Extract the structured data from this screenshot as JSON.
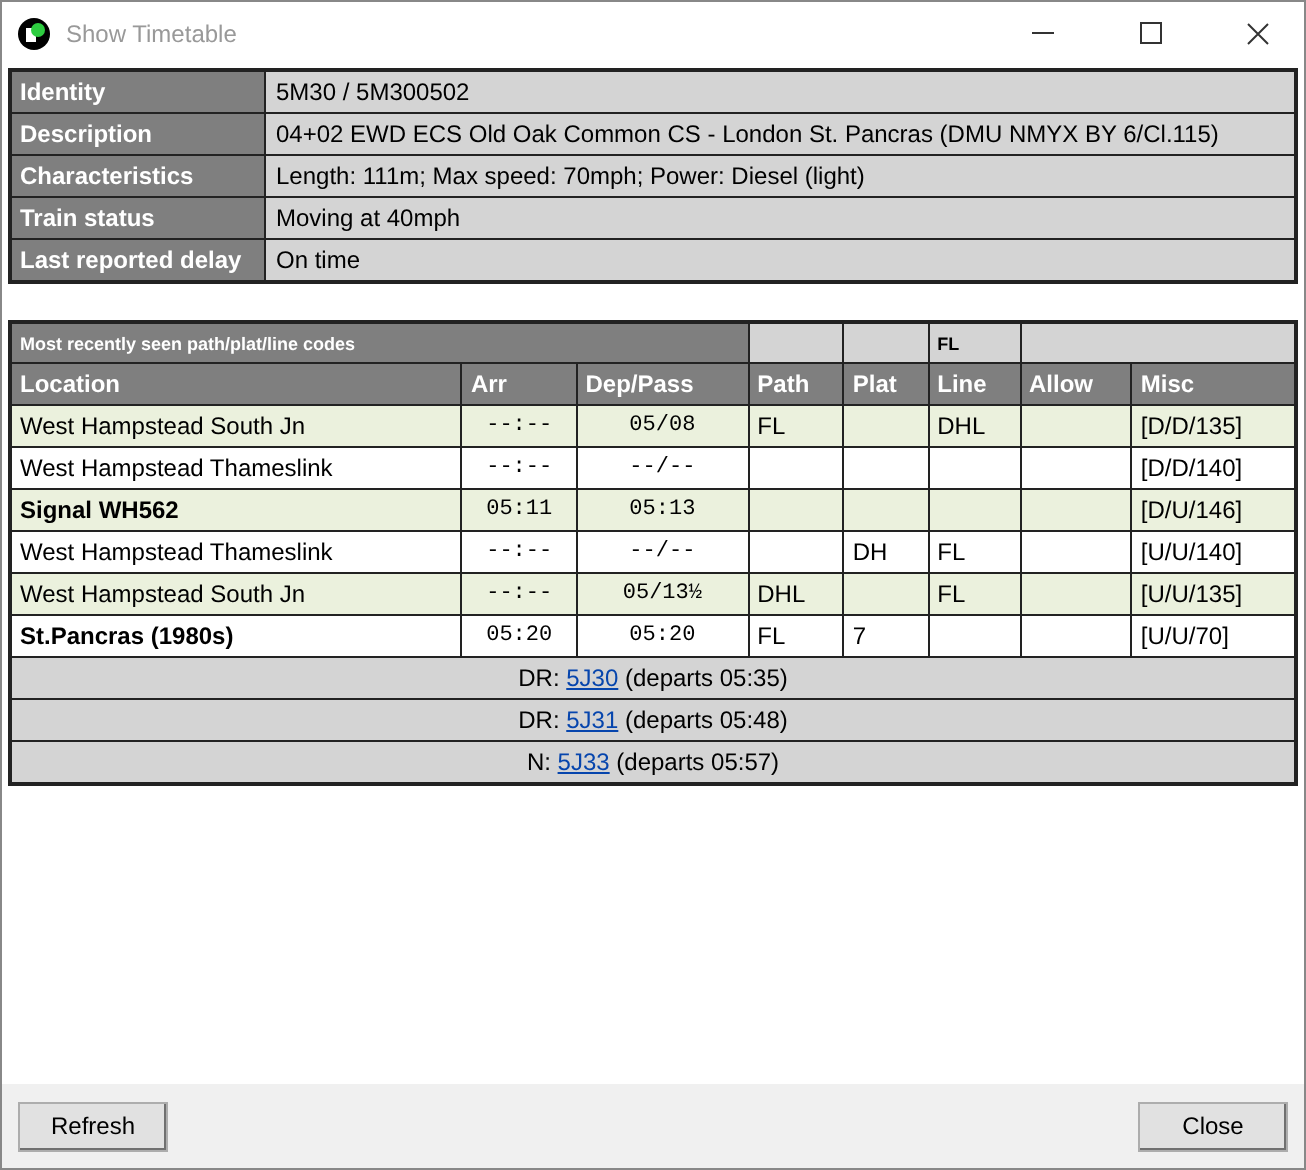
{
  "window": {
    "title": "Show Timetable"
  },
  "details": [
    {
      "label": "Identity",
      "value": "5M30 / 5M300502"
    },
    {
      "label": "Description",
      "value": "04+02 EWD ECS Old Oak Common CS - London St. Pancras (DMU NMYX BY 6/Cl.115)"
    },
    {
      "label": "Characteristics",
      "value": "Length: 111m; Max speed: 70mph; Power: Diesel (light)"
    },
    {
      "label": "Train status",
      "value": "Moving at 40mph"
    },
    {
      "label": "Last reported delay",
      "value": "On time"
    }
  ],
  "timetable": {
    "codes_title": "Most recently seen path/plat/line codes",
    "codes": {
      "line": "FL"
    },
    "columns": [
      "Location",
      "Arr",
      "Dep/Pass",
      "Path",
      "Plat",
      "Line",
      "Allow",
      "Misc"
    ],
    "rows": [
      {
        "location": "West Hampstead South Jn",
        "bold": false,
        "arr": "--:--",
        "dep": "05/08",
        "path": "FL",
        "plat": "",
        "line": "DHL",
        "allow": "",
        "misc": "[D/D/135]"
      },
      {
        "location": "West Hampstead Thameslink",
        "bold": false,
        "arr": "--:--",
        "dep": "--/--",
        "path": "",
        "plat": "",
        "line": "",
        "allow": "",
        "misc": "[D/D/140]"
      },
      {
        "location": "Signal WH562",
        "bold": true,
        "arr": "05:11",
        "dep": "05:13",
        "path": "",
        "plat": "",
        "line": "",
        "allow": "",
        "misc": "[D/U/146]"
      },
      {
        "location": "West Hampstead Thameslink",
        "bold": false,
        "arr": "--:--",
        "dep": "--/--",
        "path": "",
        "plat": "DH",
        "line": "FL",
        "allow": "",
        "misc": "[U/U/140]"
      },
      {
        "location": "West Hampstead South Jn",
        "bold": false,
        "arr": "--:--",
        "dep": "05/13½",
        "path": "DHL",
        "plat": "",
        "line": "FL",
        "allow": "",
        "misc": "[U/U/135]"
      },
      {
        "location": "St.Pancras (1980s)",
        "bold": true,
        "arr": "05:20",
        "dep": "05:20",
        "path": "FL",
        "plat": "7",
        "line": "",
        "allow": "",
        "misc": "[U/U/70]"
      }
    ],
    "onward": [
      {
        "prefix": "DR: ",
        "link": "5J30",
        "suffix": " (departs 05:35)"
      },
      {
        "prefix": "DR: ",
        "link": "5J31",
        "suffix": " (departs 05:48)"
      },
      {
        "prefix": "N: ",
        "link": "5J33",
        "suffix": " (departs 05:57)"
      }
    ]
  },
  "buttons": {
    "refresh": "Refresh",
    "close": "Close"
  }
}
